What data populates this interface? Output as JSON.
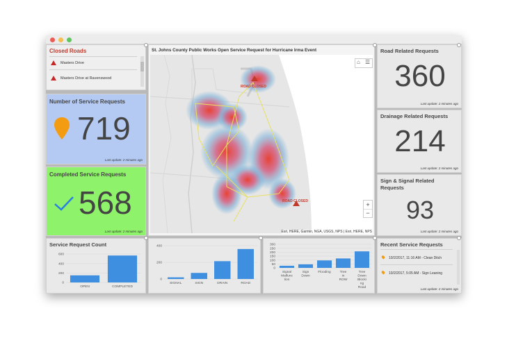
{
  "window": {
    "title_buttons": [
      "close",
      "minimize",
      "zoom"
    ]
  },
  "colors": {
    "accent": "#3f8fe0",
    "closed_title": "#c0392b",
    "completed_bg": "#8ef26a",
    "service_bg": "#b4caf3",
    "pin": "#f39c12"
  },
  "closed_roads": {
    "title": "Closed Roads",
    "items": [
      "Masters Drive",
      "Masters Drive at Ravenswood"
    ]
  },
  "service_requests": {
    "title": "Number of Service Requests",
    "value": "719",
    "footer": "Last update: 2 minutes ago",
    "icon": "map-pin-icon"
  },
  "completed_requests": {
    "title": "Completed Service Requests",
    "value": "568",
    "footer": "Last update: 2 minutes ago",
    "icon": "checkmark-icon"
  },
  "map": {
    "title": "St. Johns County Public Works Open Service Request for Hurricane Irma Event",
    "attribution": "Esri, HERE, Garmin, NGA, USGS, NPS | Esri, HERE, NPS",
    "labels": [
      "ROAD CLOSED",
      "ROAD CLOSED"
    ],
    "zoom_in": "+",
    "zoom_out": "−"
  },
  "road_related": {
    "title": "Road Related Requests",
    "value": "360",
    "footer": "Last update: 2 minutes ago"
  },
  "drainage_related": {
    "title": "Drainage Related Requests",
    "value": "214",
    "footer": "Last update: 2 minutes ago"
  },
  "sign_related": {
    "title": "Sign & Signal Related Requests",
    "value": "93",
    "footer": "Last update: 2 minutes ago"
  },
  "recent_requests": {
    "title": "Recent Service Requests",
    "items": [
      "10/2/2017, 11:16 AM - Clean Ditch",
      "10/2/2017, 5:05 AM - Sign Leaning"
    ],
    "footer": "Last update: 2 minutes ago"
  },
  "service_request_count": {
    "title": "Service Request Count"
  },
  "chart_data": [
    {
      "type": "bar",
      "title": "Service Request Count",
      "categories": [
        "OPEN",
        "COMPLETED"
      ],
      "values": [
        150,
        568
      ],
      "yticks": [
        0,
        200,
        400,
        600
      ],
      "ylim": [
        0,
        600
      ],
      "grid": true
    },
    {
      "type": "bar",
      "title": "",
      "categories": [
        "SIGNAL",
        "SIGN",
        "DRAIN",
        "ROAD"
      ],
      "values": [
        20,
        73,
        214,
        360
      ],
      "yticks": [
        0,
        200,
        400
      ],
      "ylim": [
        0,
        400
      ],
      "grid": true
    },
    {
      "type": "bar",
      "title": "",
      "categories": [
        "Signal Malfunction",
        "Sign Down",
        "Flooding",
        "Tree in ROW",
        "Tree Down Blocking Road"
      ],
      "category_lines": [
        [
          "Signal",
          "Malfunc",
          "tion"
        ],
        [
          "Sign",
          "Down"
        ],
        [
          "Flooding"
        ],
        [
          "Tree",
          "in",
          "ROW"
        ],
        [
          "Tree",
          "Down",
          "Blocki",
          "ng",
          "Road"
        ]
      ],
      "values": [
        27,
        45,
        95,
        120,
        210
      ],
      "yticks": [
        0,
        50,
        100,
        150,
        200,
        250,
        300
      ],
      "ylim": [
        0,
        300
      ],
      "grid": true
    }
  ]
}
